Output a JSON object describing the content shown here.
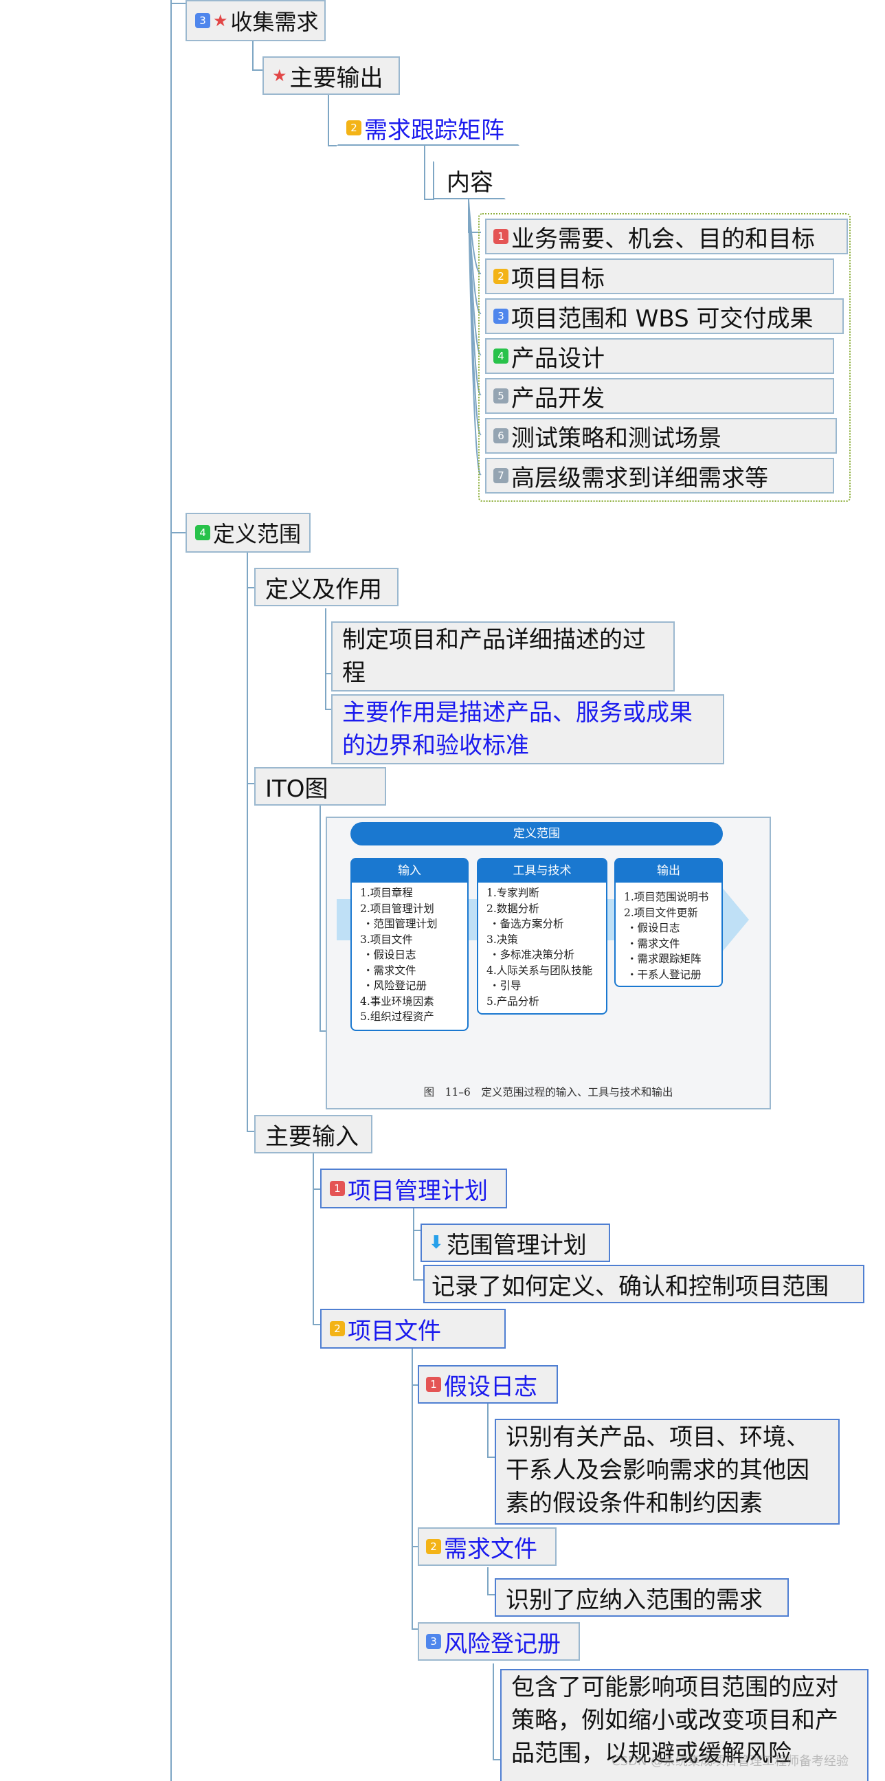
{
  "nodes": {
    "collect_requirements": {
      "index": "3",
      "label": "收集需求"
    },
    "main_outputs": {
      "label": "主要输出"
    },
    "rtm": {
      "index": "2",
      "label": "需求跟踪矩阵"
    },
    "content": {
      "label": "内容"
    },
    "rtm_items": [
      {
        "index": "1",
        "label": "业务需要、机会、目的和目标"
      },
      {
        "index": "2",
        "label": "项目目标"
      },
      {
        "index": "3",
        "label": "项目范围和 WBS 可交付成果"
      },
      {
        "index": "4",
        "label": "产品设计"
      },
      {
        "index": "5",
        "label": "产品开发"
      },
      {
        "index": "6",
        "label": "测试策略和测试场景"
      },
      {
        "index": "7",
        "label": "高层级需求到详细需求等"
      }
    ],
    "define_scope": {
      "index": "4",
      "label": "定义范围"
    },
    "definition_role": {
      "label": "定义及作用"
    },
    "definition_text": "制定项目和产品详细描述的过程",
    "role_text": "主要作用是描述产品、服务或成果的边界和验收标准",
    "ito_label": "ITO图",
    "main_inputs": {
      "label": "主要输入"
    },
    "pm_plan": {
      "index": "1",
      "label": "项目管理计划"
    },
    "scope_mgmt_plan": {
      "label": "范围管理计划"
    },
    "scope_mgmt_plan_note": "记录了如何定义、确认和控制项目范围",
    "project_docs": {
      "index": "2",
      "label": "项目文件"
    },
    "assumption_log": {
      "index": "1",
      "label": "假设日志"
    },
    "assumption_log_note": "识别有关产品、项目、环境、干系人及会影响需求的其他因素的假设条件和制约因素",
    "requirements_docs": {
      "index": "2",
      "label": "需求文件"
    },
    "requirements_docs_note": "识别了应纳入范围的需求",
    "risk_register": {
      "index": "3",
      "label": "风险登记册"
    },
    "risk_register_note": "包含了可能影响项目范围的应对策略，例如缩小或改变项目和产品范围，以规避或缓解风险"
  },
  "ito_figure": {
    "title": "定义范围",
    "inputs_title": "输入",
    "inputs": [
      "1.项目章程",
      "2.项目管理计划",
      "・范围管理计划",
      "3.项目文件",
      "・假设日志",
      "・需求文件",
      "・风险登记册",
      "4.事业环境因素",
      "5.组织过程资产"
    ],
    "tools_title": "工具与技术",
    "tools": [
      "1.专家判断",
      "2.数据分析",
      "・备选方案分析",
      "3.决策",
      "・多标准决策分析",
      "4.人际关系与团队技能",
      "・引导",
      "5.产品分析"
    ],
    "outputs_title": "输出",
    "outputs": [
      "1.项目范围说明书",
      "2.项目文件更新",
      "・假设日志",
      "・需求文件",
      "・需求跟踪矩阵",
      "・干系人登记册"
    ],
    "caption": "图　11–6　定义范围过程的输入、工具与技术和输出"
  },
  "watermark": "CSDN @系统集成项目管理工程师备考经验"
}
